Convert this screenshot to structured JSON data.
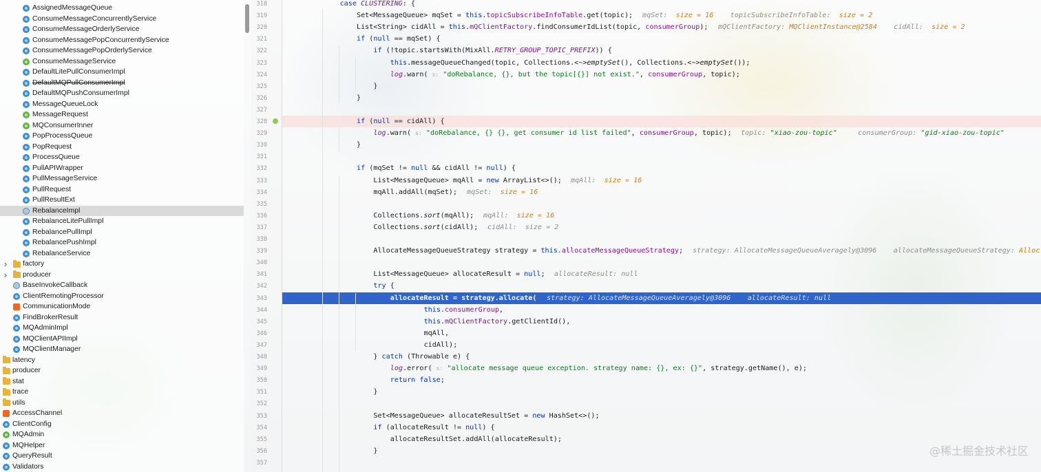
{
  "project_tree": {
    "items": [
      {
        "label": "AssignedMessageQueue",
        "icon": "class-icon",
        "indent": 2
      },
      {
        "label": "ConsumeMessageConcurrentlyService",
        "icon": "class-icon",
        "indent": 2
      },
      {
        "label": "ConsumeMessageOrderlyService",
        "icon": "class-icon",
        "indent": 2
      },
      {
        "label": "ConsumeMessagePopConcurrentlyService",
        "icon": "class-icon",
        "indent": 2
      },
      {
        "label": "ConsumeMessagePopOrderlyService",
        "icon": "class-icon",
        "indent": 2
      },
      {
        "label": "ConsumeMessageService",
        "icon": "interface-icon",
        "indent": 2
      },
      {
        "label": "DefaultLitePullConsumerImpl",
        "icon": "class-icon",
        "indent": 2
      },
      {
        "label": "DefaultMQPullConsumerImpl",
        "icon": "class-icon",
        "indent": 2,
        "strike": true
      },
      {
        "label": "DefaultMQPushConsumerImpl",
        "icon": "class-icon",
        "indent": 2
      },
      {
        "label": "MessageQueueLock",
        "icon": "class-icon",
        "indent": 2
      },
      {
        "label": "MessageRequest",
        "icon": "interface-icon",
        "indent": 2
      },
      {
        "label": "MQConsumerInner",
        "icon": "interface-icon",
        "indent": 2
      },
      {
        "label": "PopProcessQueue",
        "icon": "class-icon",
        "indent": 2
      },
      {
        "label": "PopRequest",
        "icon": "class-icon",
        "indent": 2
      },
      {
        "label": "ProcessQueue",
        "icon": "class-icon",
        "indent": 2
      },
      {
        "label": "PullAPIWrapper",
        "icon": "class-icon",
        "indent": 2
      },
      {
        "label": "PullMessageService",
        "icon": "class-icon",
        "indent": 2
      },
      {
        "label": "PullRequest",
        "icon": "class-icon",
        "indent": 2
      },
      {
        "label": "PullResultExt",
        "icon": "class-icon",
        "indent": 2
      },
      {
        "label": "RebalanceImpl",
        "icon": "abstract-class-icon",
        "indent": 2,
        "selected": true
      },
      {
        "label": "RebalanceLitePullImpl",
        "icon": "class-icon",
        "indent": 2
      },
      {
        "label": "RebalancePullImpl",
        "icon": "class-icon",
        "indent": 2
      },
      {
        "label": "RebalancePushImpl",
        "icon": "class-icon",
        "indent": 2
      },
      {
        "label": "RebalanceService",
        "icon": "class-icon",
        "indent": 2
      },
      {
        "label": "factory",
        "icon": "folder-icon",
        "indent": 1,
        "chevron": true
      },
      {
        "label": "producer",
        "icon": "folder-icon",
        "indent": 1,
        "chevron": true
      },
      {
        "label": "BaseInvokeCallback",
        "icon": "abstract-class-icon",
        "indent": 1
      },
      {
        "label": "ClientRemotingProcessor",
        "icon": "class-icon",
        "indent": 1
      },
      {
        "label": "CommunicationMode",
        "icon": "enum-icon",
        "indent": 1
      },
      {
        "label": "FindBrokerResult",
        "icon": "class-icon",
        "indent": 1
      },
      {
        "label": "MQAdminImpl",
        "icon": "class-icon",
        "indent": 1
      },
      {
        "label": "MQClientAPIImpl",
        "icon": "class-icon",
        "indent": 1
      },
      {
        "label": "MQClientManager",
        "icon": "class-icon",
        "indent": 1
      },
      {
        "label": "latency",
        "icon": "folder-icon",
        "indent": 0
      },
      {
        "label": "producer",
        "icon": "folder-icon",
        "indent": 0
      },
      {
        "label": "stat",
        "icon": "folder-icon",
        "indent": 0
      },
      {
        "label": "trace",
        "icon": "folder-icon",
        "indent": 0
      },
      {
        "label": "utils",
        "icon": "folder-icon",
        "indent": 0
      },
      {
        "label": "AccessChannel",
        "icon": "enum-icon",
        "indent": 0
      },
      {
        "label": "ClientConfig",
        "icon": "class-icon",
        "indent": 0
      },
      {
        "label": "MQAdmin",
        "icon": "interface-icon",
        "indent": 0
      },
      {
        "label": "MQHelper",
        "icon": "class-icon",
        "indent": 0
      },
      {
        "label": "QueryResult",
        "icon": "class-icon",
        "indent": 0
      },
      {
        "label": "Validators",
        "icon": "class-icon",
        "indent": 0
      }
    ]
  },
  "editor": {
    "lines": [
      {
        "n": "318",
        "html": "<span class=\"kw\">case</span> <span class=\"fld it\">CLUSTERING</span>: {",
        "indent": 4
      },
      {
        "n": "319",
        "html": "Set&lt;MessageQueue&gt; mqSet = <span class=\"kw\">this</span>.<span class=\"fld\">topicSubscribeInfoTable</span>.get(topic);",
        "indent": 5,
        "hint": "mqSet:  <span class=\"hintval\">size = 16</span>    topicSubscribeInfoTable:  <span class=\"hintval\">size = 2</span>"
      },
      {
        "n": "320",
        "html": "List&lt;String&gt; cidAll = <span class=\"kw\">this</span>.<span class=\"fld\">mQClientFactory</span>.findConsumerIdList(topic, <span class=\"fld\">consumerGroup</span>);",
        "indent": 5,
        "hint": "mQClientFactory: <span class=\"hintval\">MQClientInstance@2584</span>    cidAll:  <span class=\"hintval\">size = 2</span>"
      },
      {
        "n": "321",
        "html": "<span class=\"kw\">if</span> (<span class=\"kw\">null</span> == mqSet) {",
        "indent": 5
      },
      {
        "n": "322",
        "html": "<span class=\"kw\">if</span> (!topic.startsWith(MixAll.<span class=\"fld it\">RETRY_GROUP_TOPIC_PREFIX</span>)) {",
        "indent": 6
      },
      {
        "n": "323",
        "html": "<span class=\"kw\">this</span>.messageQueueChanged(topic, Collections.&lt;~&gt;<span class=\"it\">emptySet</span>(), Collections.&lt;~&gt;<span class=\"it\">emptySet</span>());",
        "indent": 7
      },
      {
        "n": "324",
        "html": "<span class=\"fld it\">log</span>.warn( <span class=\"lognote\">s:</span> <span class=\"str\">\"doRebalance, {}, but the topic[{}] not exist.\"</span>, <span class=\"fld\">consumerGroup</span>, topic);",
        "indent": 7
      },
      {
        "n": "325",
        "html": "}",
        "indent": 6
      },
      {
        "n": "326",
        "html": "}",
        "indent": 5
      },
      {
        "n": "327",
        "html": "",
        "indent": 5
      },
      {
        "n": "328",
        "html": "<span class=\"kw\">if</span> (<span class=\"kw\">null</span> == cidAll) {",
        "indent": 5,
        "err": true
      },
      {
        "n": "329",
        "html": "<span class=\"fld it\">log</span>.warn( <span class=\"lognote\">s:</span> <span class=\"str\">\"doRebalance, {} {}, get consumer id list failed\"</span>, <span class=\"fld\">consumerGroup</span>, topic);",
        "indent": 6,
        "hint": "topic: <span class=\"hintstr\">\"xiao-zou-topic\"</span>     consumerGroup: <span class=\"hintstr\">\"gid-xiao-zou-topic\"</span>"
      },
      {
        "n": "330",
        "html": "}",
        "indent": 5
      },
      {
        "n": "331",
        "html": "",
        "indent": 5
      },
      {
        "n": "332",
        "html": "<span class=\"kw\">if</span> (mqSet != <span class=\"kw\">null</span> &amp;&amp; cidAll != <span class=\"kw\">null</span>) {",
        "indent": 5
      },
      {
        "n": "333",
        "html": "List&lt;MessageQueue&gt; mqAll = <span class=\"kw\">new</span> ArrayList&lt;&gt;();",
        "indent": 6,
        "hint": "mqAll:  <span class=\"hintval\">size = 16</span>"
      },
      {
        "n": "334",
        "html": "mqAll.addAll(mqSet);",
        "indent": 6,
        "hint": "mqSet:  <span class=\"hintval\">size = 16</span>"
      },
      {
        "n": "335",
        "html": "",
        "indent": 6
      },
      {
        "n": "336",
        "html": "Collections.<span class=\"it\">sort</span>(mqAll);",
        "indent": 6,
        "hint": "mqAll:  <span class=\"hintval\">size = 16</span>"
      },
      {
        "n": "337",
        "html": "Collections.<span class=\"it\">sort</span>(cidAll);",
        "indent": 6,
        "hint": "cidAll:  size = 2"
      },
      {
        "n": "338",
        "html": "",
        "indent": 6
      },
      {
        "n": "339",
        "html": "AllocateMessageQueueStrategy strategy = <span class=\"kw\">this</span>.<span class=\"fld\">allocateMessageQueueStrategy</span>;",
        "indent": 6,
        "hint": "strategy: AllocateMessageQueueAveragely@3096    allocateMessageQueueStrategy: <span class=\"hintval\">Alloc</span>"
      },
      {
        "n": "340",
        "html": "",
        "indent": 6
      },
      {
        "n": "341",
        "html": "List&lt;MessageQueue&gt; allocateResult = <span class=\"kw\">null</span>;",
        "indent": 6,
        "hint": "allocateResult: null"
      },
      {
        "n": "342",
        "html": "<span class=\"kw\">try</span> {",
        "indent": 6
      },
      {
        "n": "343",
        "html": "<b>allocateResult = strategy.allocate(</b>",
        "indent": 7,
        "exec": true,
        "hint": "strategy: AllocateMessageQueueAveragely@3096    allocateResult: null"
      },
      {
        "n": "344",
        "html": "<span class=\"kw\">this</span>.<span class=\"fld\">consumerGroup</span>,",
        "indent": 9
      },
      {
        "n": "345",
        "html": "<span class=\"kw\">this</span>.<span class=\"fld\">mQClientFactory</span>.getClientId(),",
        "indent": 9
      },
      {
        "n": "346",
        "html": "mqAll,",
        "indent": 9
      },
      {
        "n": "347",
        "html": "cidAll);",
        "indent": 9
      },
      {
        "n": "348",
        "html": "} <span class=\"kw\">catch</span> (Throwable e) {",
        "indent": 6
      },
      {
        "n": "349",
        "html": "<span class=\"fld it\">log</span>.error( <span class=\"lognote\">s:</span> <span class=\"str\">\"allocate message queue exception. strategy name: {}, ex: {}\"</span>, strategy.getName(), e);",
        "indent": 7
      },
      {
        "n": "350",
        "html": "<span class=\"kw\">return false</span>;",
        "indent": 7
      },
      {
        "n": "351",
        "html": "}",
        "indent": 6
      },
      {
        "n": "352",
        "html": "",
        "indent": 6
      },
      {
        "n": "353",
        "html": "Set&lt;MessageQueue&gt; allocateResultSet = <span class=\"kw\">new</span> HashSet&lt;&gt;();",
        "indent": 6
      },
      {
        "n": "354",
        "html": "<span class=\"kw\">if</span> (allocateResult != <span class=\"kw\">null</span>) {",
        "indent": 6
      },
      {
        "n": "355",
        "html": "allocateResultSet.addAll(allocateResult);",
        "indent": 7
      },
      {
        "n": "356",
        "html": "}",
        "indent": 6
      },
      {
        "n": "357",
        "html": "",
        "indent": 6
      }
    ]
  },
  "watermark": "@稀土掘金技术社区",
  "colors": {
    "selection": "#2f65ca",
    "keyword": "#0033b3",
    "field": "#871094",
    "string": "#067d17"
  }
}
